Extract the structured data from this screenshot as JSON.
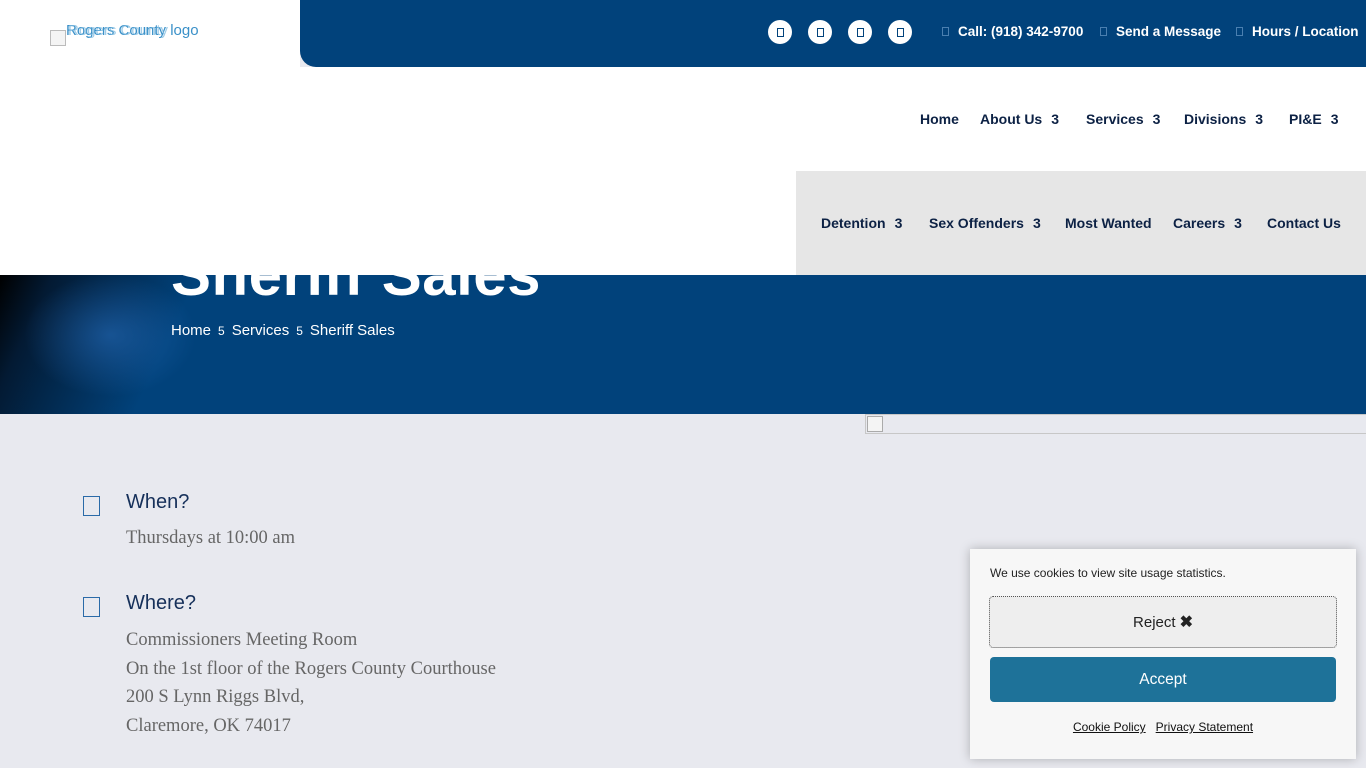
{
  "header": {
    "logo_alt": "Rogers County logo",
    "logo_alt_overlay": "Rogers County",
    "social_icons": [
      "facebook-icon",
      "twitter-icon",
      "instagram-icon",
      "youtube-icon"
    ],
    "contact_links": [
      {
        "label": "Call: (918) 342-9700",
        "icon": "phone-icon"
      },
      {
        "label": "Send a Message",
        "icon": "envelope-icon"
      },
      {
        "label": "Hours / Location",
        "icon": "map-marker-icon"
      }
    ]
  },
  "nav": {
    "dropdown_glyph": "3",
    "primary": [
      {
        "label": "Home"
      },
      {
        "label": "About Us"
      },
      {
        "label": "Services"
      },
      {
        "label": "Divisions"
      },
      {
        "label": "PI&E"
      }
    ],
    "secondary": [
      {
        "label": "Detention"
      },
      {
        "label": "Sex Offenders"
      },
      {
        "label": "Most Wanted"
      },
      {
        "label": "Careers"
      },
      {
        "label": "Contact Us"
      }
    ]
  },
  "hero": {
    "title": "Sheriff Sales",
    "breadcrumb": [
      "Home",
      "Services",
      "Sheriff Sales"
    ],
    "breadcrumb_separator": "5"
  },
  "content": {
    "when": {
      "title": "When?",
      "lines": [
        "Thursdays at 10:00 am"
      ]
    },
    "where": {
      "title": "Where?",
      "lines": [
        "Commissioners Meeting Room",
        "On the 1st floor of the Rogers County Courthouse",
        "200 S Lynn Riggs Blvd,",
        "Claremore, OK 74017"
      ]
    }
  },
  "cookie_banner": {
    "message": "We use cookies to view site usage statistics.",
    "reject_label": "Reject",
    "reject_icon": "✖",
    "accept_label": "Accept",
    "links": [
      "Cookie Policy",
      "Privacy Statement"
    ]
  },
  "colors": {
    "brand_blue": "#01427b",
    "nav_text": "#0c2144",
    "accept_button": "#1e7299",
    "page_background": "#e8e9ef"
  }
}
